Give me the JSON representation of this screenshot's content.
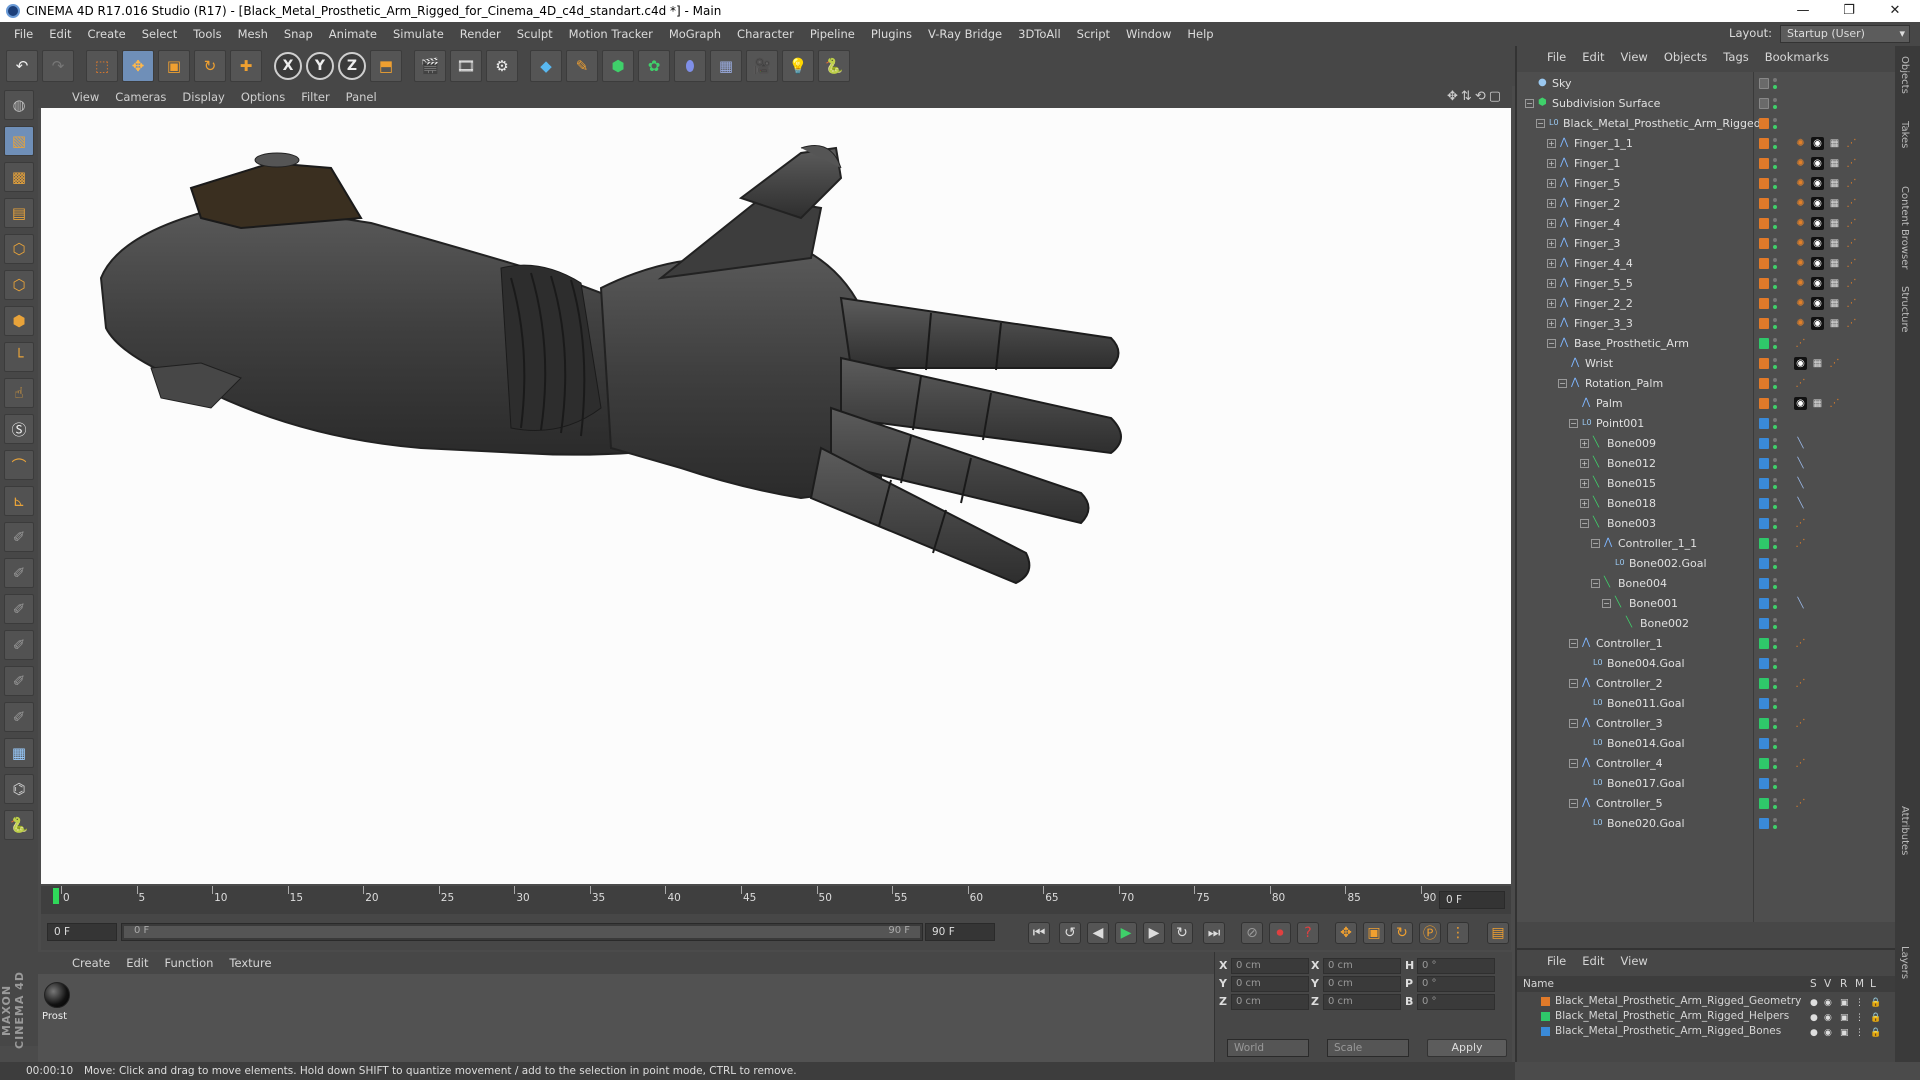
{
  "window": {
    "title": "CINEMA 4D R17.016 Studio (R17) - [Black_Metal_Prosthetic_Arm_Rigged_for_Cinema_4D_c4d_standart.c4d *] - Main",
    "minimize": "—",
    "maximize": "❐",
    "close": "✕"
  },
  "menu": [
    "File",
    "Edit",
    "Create",
    "Select",
    "Tools",
    "Mesh",
    "Snap",
    "Animate",
    "Simulate",
    "Render",
    "Sculpt",
    "Motion Tracker",
    "MoGraph",
    "Character",
    "Pipeline",
    "Plugins",
    "V-Ray Bridge",
    "3DToAll",
    "Script",
    "Window",
    "Help"
  ],
  "layout": {
    "label": "Layout:",
    "value": "Startup (User)"
  },
  "toolbar_icons": [
    "undo-icon",
    "redo-icon",
    "live-select-icon",
    "move-icon",
    "scale-icon",
    "rotate-icon",
    "add-icon",
    "x-axis-icon",
    "y-axis-icon",
    "z-axis-icon",
    "coordinate-system-icon",
    "render-view-icon",
    "render-picture-viewer-icon",
    "edit-render-settings-icon",
    "cube-icon",
    "pen-icon",
    "subdivision-icon",
    "cloner-icon",
    "deformer-icon",
    "floor-icon",
    "camera-icon",
    "light-icon",
    "python-icon"
  ],
  "viewport_menu": [
    "View",
    "Cameras",
    "Display",
    "Options",
    "Filter",
    "Panel"
  ],
  "timeline": {
    "ticks": [
      "0",
      "5",
      "10",
      "15",
      "20",
      "25",
      "30",
      "35",
      "40",
      "45",
      "50",
      "55",
      "60",
      "65",
      "70",
      "75",
      "80",
      "85",
      "90"
    ],
    "current_frame": "0 F",
    "end_field": "0 F",
    "start_field": "0 F",
    "scrub_left": "0 F",
    "scrub_right": "90 F",
    "max_field": "90 F"
  },
  "material_menu": [
    "Create",
    "Edit",
    "Function",
    "Texture"
  ],
  "material": {
    "name": "Prost"
  },
  "coords": {
    "rows": [
      {
        "a": "X",
        "av": "0 cm",
        "b": "X",
        "bv": "0 cm",
        "c": "H",
        "cv": "0 °"
      },
      {
        "a": "Y",
        "av": "0 cm",
        "b": "Y",
        "bv": "0 cm",
        "c": "P",
        "cv": "0 °"
      },
      {
        "a": "Z",
        "av": "0 cm",
        "b": "Z",
        "bv": "0 cm",
        "c": "B",
        "cv": "0 °"
      }
    ],
    "world": "World",
    "scale": "Scale",
    "apply": "Apply"
  },
  "status": {
    "time": "00:00:10",
    "text": "Move: Click and drag to move elements. Hold down SHIFT to quantize movement / add to the selection in point mode, CTRL to remove."
  },
  "objects_menu": [
    "File",
    "Edit",
    "View",
    "Objects",
    "Tags",
    "Bookmarks"
  ],
  "objects": [
    {
      "name": "Sky",
      "depth": 0,
      "icon": "sky",
      "layer": "",
      "expand": ""
    },
    {
      "name": "Subdivision Surface",
      "depth": 0,
      "icon": "subdiv",
      "layer": "",
      "expand": "−"
    },
    {
      "name": "Black_Metal_Prosthetic_Arm_Rigged",
      "depth": 1,
      "icon": "null",
      "layer": "#e07a2a",
      "expand": "−"
    },
    {
      "name": "Finger_1_1",
      "depth": 2,
      "icon": "joint",
      "layer": "#e07a2a",
      "expand": "+"
    },
    {
      "name": "Finger_1",
      "depth": 2,
      "icon": "joint",
      "layer": "#e07a2a",
      "expand": "+"
    },
    {
      "name": "Finger_5",
      "depth": 2,
      "icon": "joint",
      "layer": "#e07a2a",
      "expand": "+"
    },
    {
      "name": "Finger_2",
      "depth": 2,
      "icon": "joint",
      "layer": "#e07a2a",
      "expand": "+"
    },
    {
      "name": "Finger_4",
      "depth": 2,
      "icon": "joint",
      "layer": "#e07a2a",
      "expand": "+"
    },
    {
      "name": "Finger_3",
      "depth": 2,
      "icon": "joint",
      "layer": "#e07a2a",
      "expand": "+"
    },
    {
      "name": "Finger_4_4",
      "depth": 2,
      "icon": "joint",
      "layer": "#e07a2a",
      "expand": "+"
    },
    {
      "name": "Finger_5_5",
      "depth": 2,
      "icon": "joint",
      "layer": "#e07a2a",
      "expand": "+"
    },
    {
      "name": "Finger_2_2",
      "depth": 2,
      "icon": "joint",
      "layer": "#e07a2a",
      "expand": "+"
    },
    {
      "name": "Finger_3_3",
      "depth": 2,
      "icon": "joint",
      "layer": "#e07a2a",
      "expand": "+"
    },
    {
      "name": "Base_Prosthetic_Arm",
      "depth": 2,
      "icon": "joint",
      "layer": "#2fc86a",
      "expand": "−"
    },
    {
      "name": "Wrist",
      "depth": 3,
      "icon": "joint",
      "layer": "#e07a2a",
      "expand": ""
    },
    {
      "name": "Rotation_Palm",
      "depth": 3,
      "icon": "joint",
      "layer": "#e07a2a",
      "expand": "−"
    },
    {
      "name": "Palm",
      "depth": 4,
      "icon": "joint",
      "layer": "#e07a2a",
      "expand": ""
    },
    {
      "name": "Point001",
      "depth": 4,
      "icon": "null",
      "layer": "#3a8ad8",
      "expand": "−"
    },
    {
      "name": "Bone009",
      "depth": 5,
      "icon": "bone",
      "layer": "#3a8ad8",
      "expand": "+"
    },
    {
      "name": "Bone012",
      "depth": 5,
      "icon": "bone",
      "layer": "#3a8ad8",
      "expand": "+"
    },
    {
      "name": "Bone015",
      "depth": 5,
      "icon": "bone",
      "layer": "#3a8ad8",
      "expand": "+"
    },
    {
      "name": "Bone018",
      "depth": 5,
      "icon": "bone",
      "layer": "#3a8ad8",
      "expand": "+"
    },
    {
      "name": "Bone003",
      "depth": 5,
      "icon": "bone",
      "layer": "#3a8ad8",
      "expand": "−"
    },
    {
      "name": "Controller_1_1",
      "depth": 6,
      "icon": "joint",
      "layer": "#2fc86a",
      "expand": "−"
    },
    {
      "name": "Bone002.Goal",
      "depth": 7,
      "icon": "null",
      "layer": "#3a8ad8",
      "expand": ""
    },
    {
      "name": "Bone004",
      "depth": 6,
      "icon": "bone",
      "layer": "#3a8ad8",
      "expand": "−"
    },
    {
      "name": "Bone001",
      "depth": 7,
      "icon": "bone",
      "layer": "#3a8ad8",
      "expand": "−"
    },
    {
      "name": "Bone002",
      "depth": 8,
      "icon": "bone",
      "layer": "#3a8ad8",
      "expand": ""
    },
    {
      "name": "Controller_1",
      "depth": 4,
      "icon": "joint",
      "layer": "#2fc86a",
      "expand": "−"
    },
    {
      "name": "Bone004.Goal",
      "depth": 5,
      "icon": "null",
      "layer": "#3a8ad8",
      "expand": ""
    },
    {
      "name": "Controller_2",
      "depth": 4,
      "icon": "joint",
      "layer": "#2fc86a",
      "expand": "−"
    },
    {
      "name": "Bone011.Goal",
      "depth": 5,
      "icon": "null",
      "layer": "#3a8ad8",
      "expand": ""
    },
    {
      "name": "Controller_3",
      "depth": 4,
      "icon": "joint",
      "layer": "#2fc86a",
      "expand": "−"
    },
    {
      "name": "Bone014.Goal",
      "depth": 5,
      "icon": "null",
      "layer": "#3a8ad8",
      "expand": ""
    },
    {
      "name": "Controller_4",
      "depth": 4,
      "icon": "joint",
      "layer": "#2fc86a",
      "expand": "−"
    },
    {
      "name": "Bone017.Goal",
      "depth": 5,
      "icon": "null",
      "layer": "#3a8ad8",
      "expand": ""
    },
    {
      "name": "Controller_5",
      "depth": 4,
      "icon": "joint",
      "layer": "#2fc86a",
      "expand": "−"
    },
    {
      "name": "Bone020.Goal",
      "depth": 5,
      "icon": "null",
      "layer": "#3a8ad8",
      "expand": ""
    }
  ],
  "layers_menu": [
    "File",
    "Edit",
    "View"
  ],
  "layers_header": {
    "name": "Name",
    "s": "S",
    "v": "V",
    "r": "R",
    "m": "M",
    "l": "L"
  },
  "layers": [
    {
      "name": "Black_Metal_Prosthetic_Arm_Rigged_Geometry",
      "color": "#e07a2a"
    },
    {
      "name": "Black_Metal_Prosthetic_Arm_Rigged_Helpers",
      "color": "#2fc86a"
    },
    {
      "name": "Black_Metal_Prosthetic_Arm_Rigged_Bones",
      "color": "#3a8ad8"
    }
  ],
  "side_tabs": [
    "Objects",
    "Takes",
    "Content Browser",
    "Structure",
    "Attributes",
    "Layers"
  ],
  "maxon_logo": "MAXON CINEMA 4D"
}
